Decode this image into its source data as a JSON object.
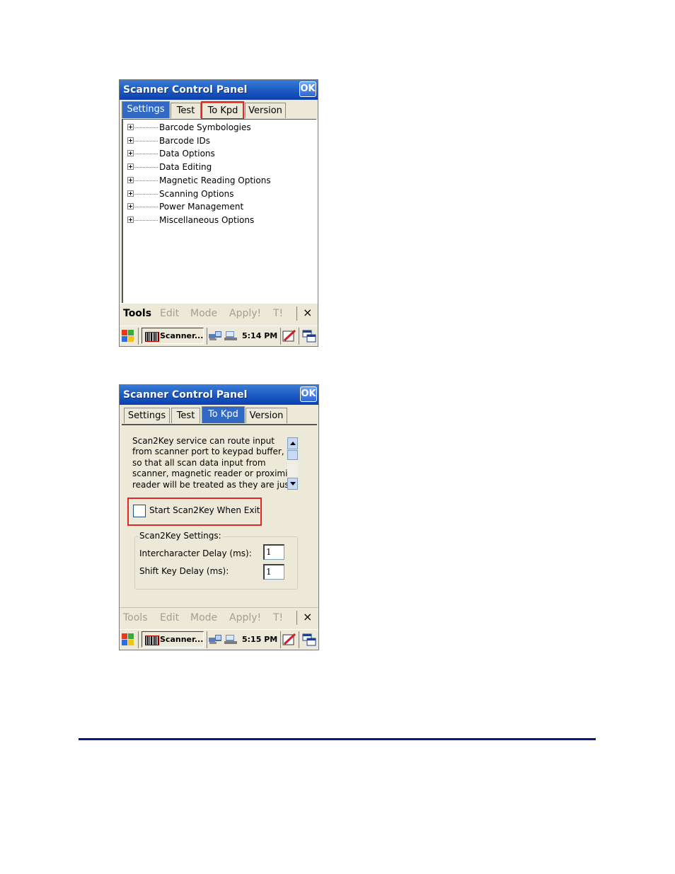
{
  "screens": [
    {
      "title": "Scanner Control Panel",
      "ok_label": "OK",
      "tabs": [
        "Settings",
        "Test",
        "To Kpd",
        "Version"
      ],
      "active_tab": "Settings",
      "tree_items": [
        "Barcode Symbologies",
        "Barcode IDs",
        "Data Options",
        "Data Editing",
        "Magnetic Reading Options",
        "Scanning Options",
        "Power Management",
        "Miscellaneous Options"
      ],
      "menu": [
        "Tools",
        "Edit",
        "Mode",
        "Apply!",
        "T!"
      ],
      "menu_close": "×",
      "taskbar": {
        "app": "Scanner...",
        "time": "5:14 PM"
      }
    },
    {
      "title": "Scanner Control Panel",
      "ok_label": "OK",
      "tabs": [
        "Settings",
        "Test",
        "To Kpd",
        "Version"
      ],
      "active_tab": "To Kpd",
      "description": "Scan2Key service can route input\nfrom scanner port to keypad buffer,\nso that all scan data input from\nscanner, magnetic reader or proximity\nreader will be treated as they are just",
      "checkbox_label": "Start Scan2Key When Exit",
      "checkbox_checked": false,
      "group_label": "Scan2Key Settings:",
      "fields": [
        {
          "label": "Intercharacter Delay (ms):",
          "value": "1"
        },
        {
          "label": "Shift Key Delay (ms):",
          "value": "1"
        }
      ],
      "menu": [
        "Tools",
        "Edit",
        "Mode",
        "Apply!",
        "T!"
      ],
      "menu_close": "×",
      "taskbar": {
        "app": "Scanner...",
        "time": "5:15 PM"
      }
    }
  ],
  "colors": {
    "titlebar": "#1f5fc4",
    "active_tab": "#316ac5",
    "highlight_box": "#e32626",
    "rule": "#0b1a78"
  }
}
